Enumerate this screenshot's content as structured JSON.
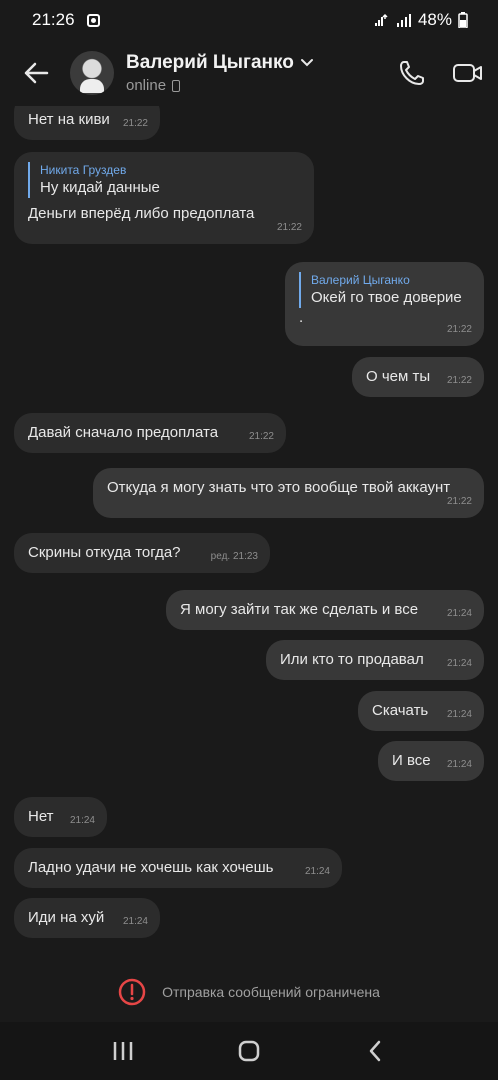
{
  "status_bar": {
    "time": "21:26",
    "battery": "48%"
  },
  "header": {
    "contact_name": "Валерий Цыганко",
    "contact_status": "online"
  },
  "messages": [
    {
      "direction": "in",
      "text": "Нет на киви",
      "time": "21:22"
    },
    {
      "direction": "in",
      "quote_author": "Никита Груздев",
      "quote_text": "Ну кидай данные",
      "text": "Деньги вперёд либо предоплата",
      "time": "21:22"
    },
    {
      "direction": "out",
      "quote_author": "Валерий Цыганко",
      "quote_text": "Окей го твое доверие",
      "text": ".",
      "time": "21:22"
    },
    {
      "direction": "out",
      "text": "О чем ты",
      "time": "21:22"
    },
    {
      "direction": "in",
      "text": "Давай сначало предоплата",
      "time": "21:22"
    },
    {
      "direction": "out",
      "text": "Откуда я могу знать что это вообще твой аккаунт",
      "time": "21:22"
    },
    {
      "direction": "in",
      "text": "Скрины откуда  тогда?",
      "time": "ред. 21:23"
    },
    {
      "direction": "out",
      "text": "Я могу зайти так же сделать и все",
      "time": "21:24"
    },
    {
      "direction": "out",
      "text": "Или кто то продавал",
      "time": "21:24"
    },
    {
      "direction": "out",
      "text": "Скачать",
      "time": "21:24"
    },
    {
      "direction": "out",
      "text": "И все",
      "time": "21:24"
    },
    {
      "direction": "in",
      "text": "Нет",
      "time": "21:24"
    },
    {
      "direction": "in",
      "text": "Ладно удачи не хочешь как хочешь",
      "time": "21:24"
    },
    {
      "direction": "in",
      "text": "Иди на хуй",
      "time": "21:24"
    }
  ],
  "footer": {
    "restricted_text": "Отправка сообщений ограничена"
  },
  "colors": {
    "background": "#1a1a1a",
    "bubble_in": "#2c2c2c",
    "bubble_out": "#383838",
    "quote_accent": "#71aaeb",
    "warning": "#e64646"
  },
  "icons": [
    "back-arrow-icon",
    "chevron-down-icon",
    "phone-icon",
    "video-call-icon",
    "error-circle-icon",
    "recent-apps-icon",
    "home-icon",
    "back-icon"
  ]
}
